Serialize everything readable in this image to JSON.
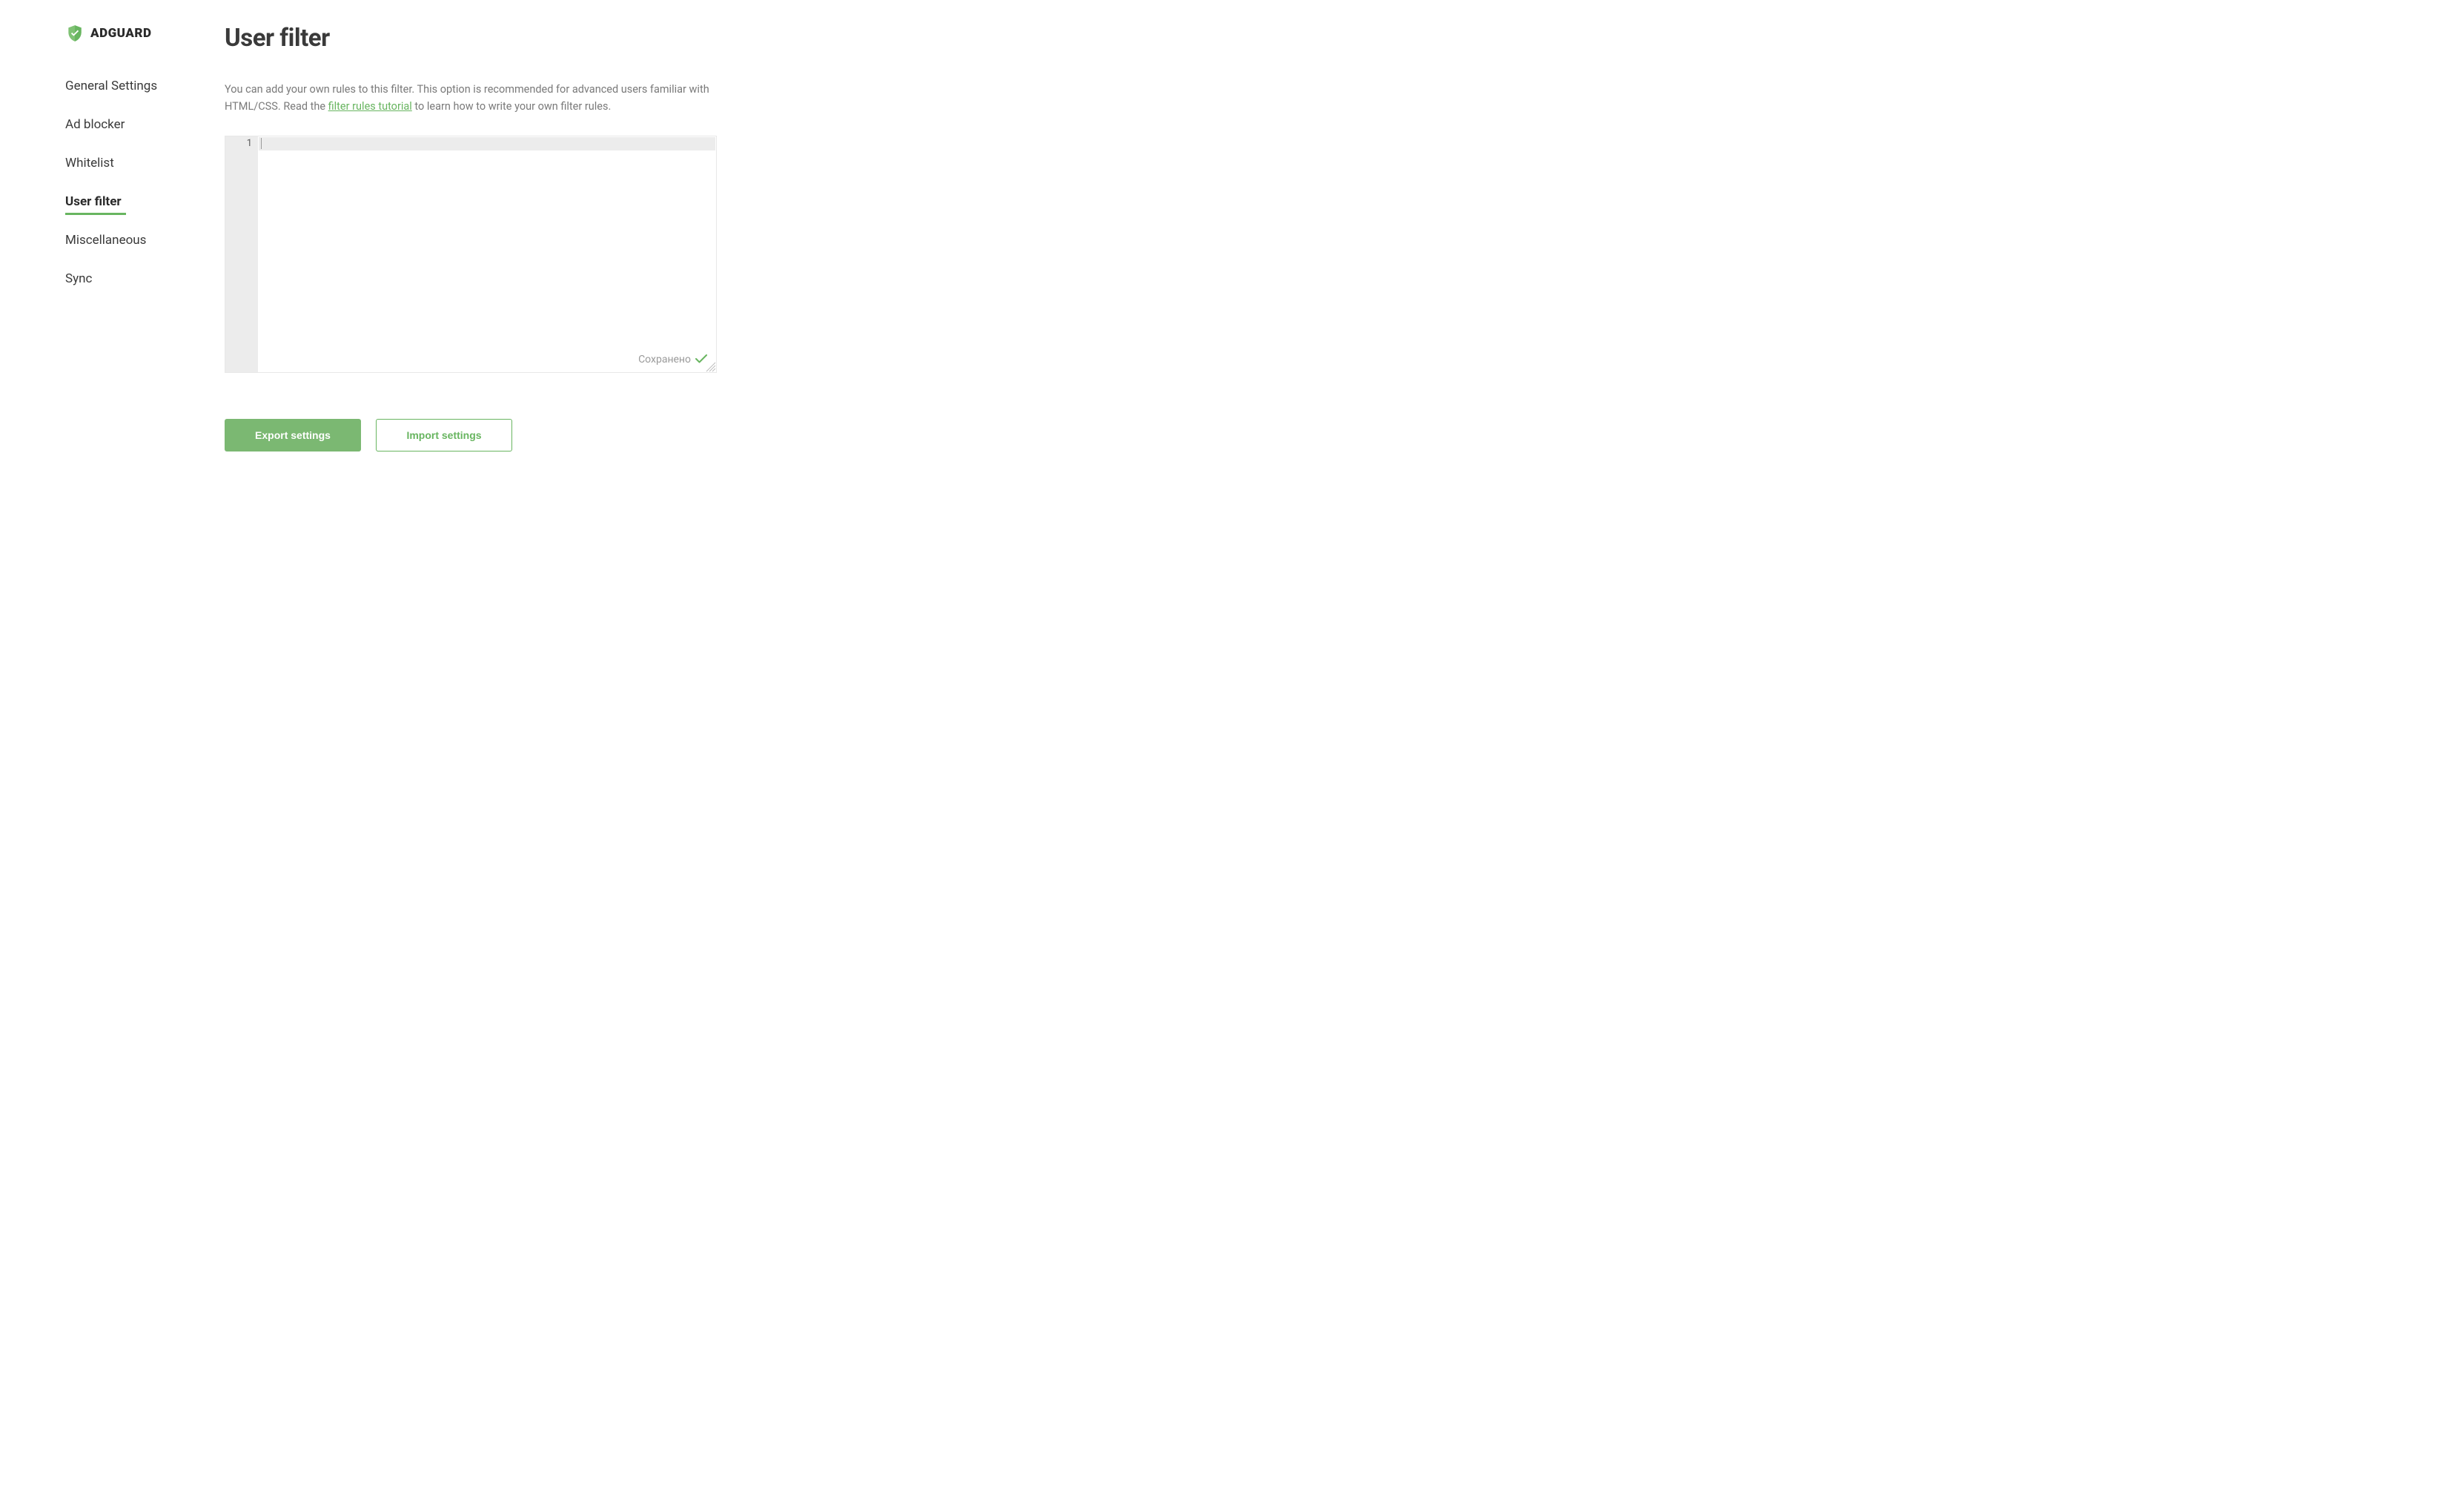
{
  "brand": {
    "name": "ADGUARD"
  },
  "sidebar": {
    "items": [
      {
        "label": "General Settings",
        "active": false
      },
      {
        "label": "Ad blocker",
        "active": false
      },
      {
        "label": "Whitelist",
        "active": false
      },
      {
        "label": "User filter",
        "active": true
      },
      {
        "label": "Miscellaneous",
        "active": false
      },
      {
        "label": "Sync",
        "active": false
      }
    ]
  },
  "main": {
    "title": "User filter",
    "description_part1": "You can add your own rules to this filter. This option is recommended for advanced users familiar with HTML/CSS. Read the ",
    "description_link": "filter rules tutorial",
    "description_part2": " to learn how to write your own filter rules."
  },
  "editor": {
    "line_number": "1",
    "saved_label": "Сохранено"
  },
  "buttons": {
    "export": "Export settings",
    "import": "Import settings"
  },
  "colors": {
    "accent": "#68b560"
  }
}
